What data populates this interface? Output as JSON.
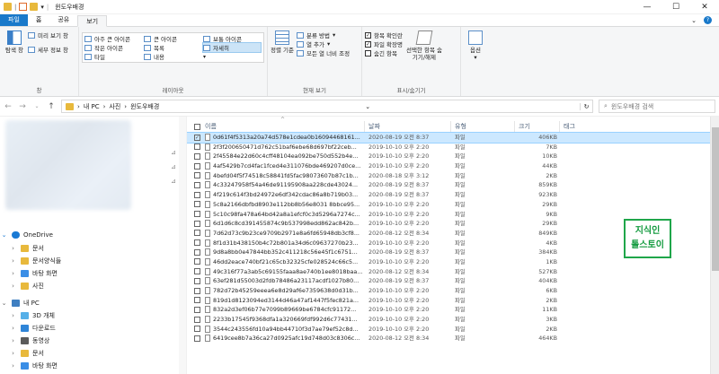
{
  "window": {
    "title": "윈도우배경",
    "controls": [
      "—",
      "☐",
      "✕"
    ]
  },
  "tabs": [
    "파일",
    "홈",
    "공유",
    "보기"
  ],
  "ribbon": {
    "pane": {
      "nav_pane": "탐색 창",
      "preview": "미리 보기 창",
      "details": "세부 정보 창",
      "title": "창"
    },
    "layout": {
      "items": [
        "아주 큰 아이콘",
        "큰 아이콘",
        "보통 아이콘",
        "작은 아이콘",
        "목록",
        "자세히",
        "타일",
        "내용"
      ],
      "selected": "자세히",
      "title": "레이아웃"
    },
    "view": {
      "sort": "정렬 기준",
      "groupby": "분류 방법",
      "addcol": "열 추가",
      "fitcols": "모든 열 너비 조정",
      "title": "현재 보기"
    },
    "showhide": {
      "checkboxes": "항목 확인란",
      "extensions": "파일 확장명",
      "hidden": "숨긴 항목",
      "hide_selected": "선택한 항목 숨기기/해제",
      "title": "표시/숨기기"
    },
    "options": "옵션"
  },
  "address": {
    "crumbs": [
      "내 PC",
      "사진",
      "윈도우배경"
    ],
    "search_placeholder": "윈도우배경 검색"
  },
  "nav": {
    "onedrive": "OneDrive",
    "od_items": [
      "문서",
      "문서양식들",
      "바탕 화면",
      "사진"
    ],
    "pc": "내 PC",
    "pc_items": [
      "3D 개체",
      "다운로드",
      "동영상",
      "문서",
      "바탕 화면"
    ]
  },
  "columns": {
    "name": "이름",
    "date": "날짜",
    "type": "유형",
    "size": "크기",
    "tag": "태그"
  },
  "files": [
    {
      "name": "0d61f4f5313a20a74d578e1cdea0b16094468161...",
      "date": "2020-08-19 오전 8:37",
      "type": "파일",
      "size": "406KB"
    },
    {
      "name": "2f3f200650471d762c51baf6ebe68d697bf22ceb...",
      "date": "2019-10-10 오후 2:20",
      "type": "파일",
      "size": "7KB"
    },
    {
      "name": "2f45584e22d60c4cff48104ea092be750d552b4e...",
      "date": "2019-10-10 오후 2:20",
      "type": "파일",
      "size": "10KB"
    },
    {
      "name": "4af5429b7cd4fac1fced4e311076bde469207d0ce...",
      "date": "2019-10-10 오후 2:20",
      "type": "파일",
      "size": "44KB"
    },
    {
      "name": "4befd04f5f74518c58841fd5fac98073607b87c1b...",
      "date": "2020-08-18 오후 3:12",
      "type": "파일",
      "size": "2KB"
    },
    {
      "name": "4c33247958f54a46de91195908aa228cde43024...",
      "date": "2020-08-19 오전 8:37",
      "type": "파일",
      "size": "859KB"
    },
    {
      "name": "4f219c614f3bd24972e6df342cdac86a8b719b03...",
      "date": "2020-08-19 오전 8:37",
      "type": "파일",
      "size": "923KB"
    },
    {
      "name": "5c8a2166dbfbd8903e112bb8b56e8031 8bbce95...",
      "date": "2019-10-10 오후 2:20",
      "type": "파일",
      "size": "29KB"
    },
    {
      "name": "5c10c98fa478a64bd42a8a1efcf0c3d5296a7274c...",
      "date": "2019-10-10 오후 2:20",
      "type": "파일",
      "size": "9KB"
    },
    {
      "name": "6d1d6c8cd391455874c9b537998edd862ac842b...",
      "date": "2019-10-10 오후 2:20",
      "type": "파일",
      "size": "29KB"
    },
    {
      "name": "7d62d73c9b23ce9709b2971e8a6fd65948db3cf8...",
      "date": "2020-08-12 오전 8:34",
      "type": "파일",
      "size": "849KB"
    },
    {
      "name": "8f1d31b438150b4c72b801a34d6c09637270b23...",
      "date": "2019-10-10 오후 2:20",
      "type": "파일",
      "size": "4KB"
    },
    {
      "name": "9d8a8bb0e47844bb352c411218c56e45f1c6751...",
      "date": "2020-08-19 오전 8:37",
      "type": "파일",
      "size": "384KB"
    },
    {
      "name": "46dd2eace740bf21c65cb32325cfe028524c66c5...",
      "date": "2019-10-10 오후 2:20",
      "type": "파일",
      "size": "1KB"
    },
    {
      "name": "49c316f77a3ab5c69155faaa8ae740b1ee8018baa...",
      "date": "2020-08-12 오전 8:34",
      "type": "파일",
      "size": "527KB"
    },
    {
      "name": "63ef281d55003d2fdb78486a23117acdf1027b80...",
      "date": "2020-08-19 오전 8:37",
      "type": "파일",
      "size": "404KB"
    },
    {
      "name": "782d72b45259eeea6e8d29af6e7359638d0d31b...",
      "date": "2019-10-10 오후 2:20",
      "type": "파일",
      "size": "6KB"
    },
    {
      "name": "819d1d8123094ed3144d46a47af1447f5fec821a...",
      "date": "2019-10-10 오후 2:20",
      "type": "파일",
      "size": "2KB"
    },
    {
      "name": "832a2d3ef06b77e7099b89669be6784cfc91172...",
      "date": "2019-10-10 오후 2:20",
      "type": "파일",
      "size": "11KB"
    },
    {
      "name": "2233b17545f9368dfa1a320669fdf992d6c77431...",
      "date": "2019-10-10 오후 2:20",
      "type": "파일",
      "size": "3KB"
    },
    {
      "name": "3544c243556fd10a94bb44710f3d7ae79ef52c8d...",
      "date": "2019-10-10 오후 2:20",
      "type": "파일",
      "size": "2KB"
    },
    {
      "name": "6419cee8b7a36ca27d0925afc19d748d03c8306c...",
      "date": "2020-08-12 오전 8:34",
      "type": "파일",
      "size": "464KB"
    }
  ],
  "watermark": [
    "지식인",
    "톨스토이"
  ]
}
